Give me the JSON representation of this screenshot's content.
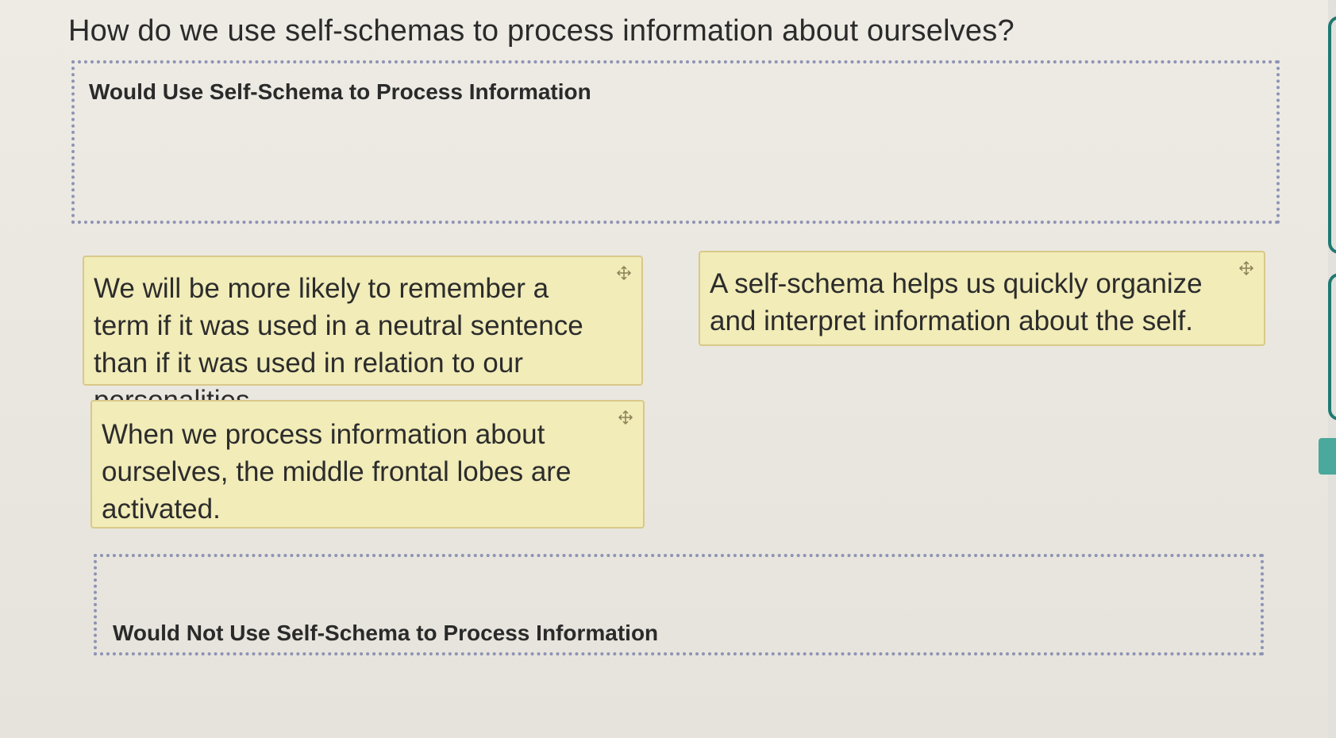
{
  "question": "How do we use self-schemas to process information about ourselves?",
  "zones": {
    "use_label": "Would Use Self-Schema to Process Information",
    "not_use_label": "Would Not Use Self-Schema to Process Information"
  },
  "cards": {
    "card1": "We will be more likely to remember a term if it was used in a neutral sentence than if it was used in relation to our personalities.",
    "card2": "A self-schema helps us quickly organize and interpret information about the self.",
    "card3": "When we process information about ourselves, the middle frontal lobes are activated."
  },
  "icons": {
    "move": "move-icon"
  },
  "colors": {
    "card_bg": "#f1ecb8",
    "card_border": "#d9c88a",
    "dropzone_border": "#8d93b4",
    "accent": "#1e7a72"
  }
}
